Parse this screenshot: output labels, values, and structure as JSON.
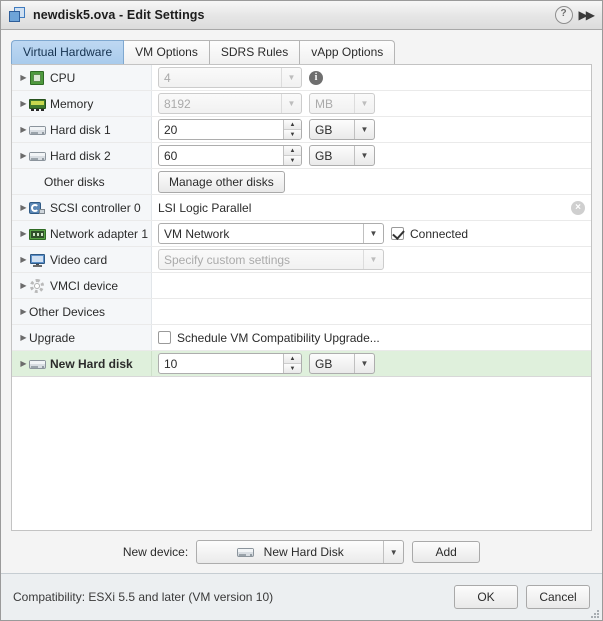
{
  "titlebar": {
    "icon": "vm-stack-icon",
    "title": "newdisk5.ova - Edit Settings",
    "help_label": "?",
    "expand_label": "▶▶"
  },
  "tabs": [
    {
      "label": "Virtual Hardware",
      "active": true
    },
    {
      "label": "VM Options",
      "active": false
    },
    {
      "label": "SDRS Rules",
      "active": false
    },
    {
      "label": "vApp Options",
      "active": false
    }
  ],
  "rows": [
    {
      "name": "CPU",
      "value": "4",
      "unit": "",
      "info": "i"
    },
    {
      "name": "Memory",
      "value": "8192",
      "unit": "MB"
    },
    {
      "name": "Hard disk 1",
      "value": "20",
      "unit": "GB"
    },
    {
      "name": "Hard disk 2",
      "value": "60",
      "unit": "GB"
    },
    {
      "name": "Other disks",
      "button": "Manage other disks"
    },
    {
      "name": "SCSI controller 0",
      "value": "LSI Logic Parallel",
      "remove": "×"
    },
    {
      "name": "Network adapter 1",
      "value": "VM Network",
      "checkbox_label": "Connected"
    },
    {
      "name": "Video card",
      "value": "Specify custom settings"
    },
    {
      "name": "VMCI device",
      "value": ""
    },
    {
      "name": "Other Devices",
      "value": ""
    },
    {
      "name": "Upgrade",
      "checkbox_label": "Schedule VM Compatibility Upgrade..."
    },
    {
      "name": "New Hard disk",
      "value": "10",
      "unit": "GB"
    }
  ],
  "new_device": {
    "label": "New device:",
    "selected": "New Hard Disk",
    "add_label": "Add"
  },
  "footer": {
    "compatibility": "Compatibility: ESXi 5.5 and later (VM version 10)",
    "ok_label": "OK",
    "cancel_label": "Cancel"
  }
}
